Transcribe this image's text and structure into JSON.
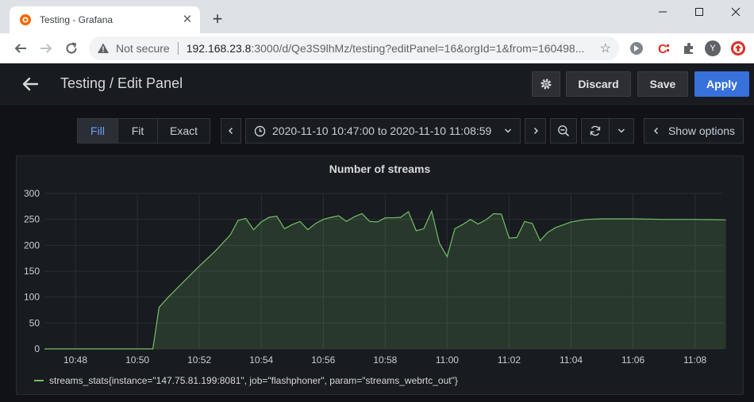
{
  "browser": {
    "tab_title": "Testing - Grafana",
    "security_label": "Not secure",
    "url_host": "192.168.23.8",
    "url_rest": ":3000/d/Qe3S9lhMz/testing?editPanel=16&orgId=1&from=160498...",
    "avatar_letter": "Y"
  },
  "header": {
    "title": "Testing / Edit Panel",
    "discard_label": "Discard",
    "save_label": "Save",
    "apply_label": "Apply"
  },
  "controls": {
    "fill_label": "Fill",
    "fit_label": "Fit",
    "exact_label": "Exact",
    "time_range": "2020-11-10 10:47:00 to 2020-11-10 11:08:59",
    "show_options_label": "Show options"
  },
  "colors": {
    "accent": "#3871dc",
    "series": "#73bf69",
    "background": "#111217",
    "panel": "#181b1f"
  },
  "chart_data": {
    "type": "area",
    "title": "Number of streams",
    "x_ticks": [
      "10:48",
      "10:50",
      "10:52",
      "10:54",
      "10:56",
      "10:58",
      "11:00",
      "11:02",
      "11:04",
      "11:06",
      "11:08"
    ],
    "x_range": [
      "10:47:00",
      "11:08:59"
    ],
    "ylim": [
      0,
      300
    ],
    "y_ticks": [
      0,
      50,
      100,
      150,
      200,
      250,
      300
    ],
    "grid": true,
    "legend": "bottom-left",
    "series": [
      {
        "name": "streams_stats{instance=\"147.75.81.199:8081\", job=\"flashphoner\", param=\"streams_webrtc_out\"}",
        "points": [
          [
            0,
            0
          ],
          [
            3,
            0
          ],
          [
            3.5,
            0
          ],
          [
            3.7,
            80
          ],
          [
            4,
            100
          ],
          [
            4.5,
            130
          ],
          [
            5,
            160
          ],
          [
            5.5,
            188
          ],
          [
            6,
            220
          ],
          [
            6.25,
            248
          ],
          [
            6.5,
            252
          ],
          [
            6.75,
            230
          ],
          [
            7,
            245
          ],
          [
            7.25,
            254
          ],
          [
            7.5,
            256
          ],
          [
            7.75,
            232
          ],
          [
            8,
            240
          ],
          [
            8.25,
            246
          ],
          [
            8.5,
            230
          ],
          [
            8.75,
            242
          ],
          [
            9,
            250
          ],
          [
            9.25,
            254
          ],
          [
            9.5,
            257
          ],
          [
            9.75,
            246
          ],
          [
            10,
            255
          ],
          [
            10.25,
            261
          ],
          [
            10.5,
            246
          ],
          [
            10.75,
            245
          ],
          [
            11,
            253
          ],
          [
            11.25,
            253
          ],
          [
            11.5,
            254
          ],
          [
            11.75,
            265
          ],
          [
            12,
            228
          ],
          [
            12.25,
            232
          ],
          [
            12.5,
            266
          ],
          [
            12.75,
            204
          ],
          [
            13,
            178
          ],
          [
            13.25,
            232
          ],
          [
            13.5,
            240
          ],
          [
            13.75,
            250
          ],
          [
            14,
            241
          ],
          [
            14.25,
            249
          ],
          [
            14.5,
            261
          ],
          [
            14.75,
            260
          ],
          [
            15,
            214
          ],
          [
            15.25,
            215
          ],
          [
            15.5,
            246
          ],
          [
            15.75,
            242
          ],
          [
            16,
            209
          ],
          [
            16.25,
            225
          ],
          [
            16.5,
            234
          ],
          [
            17,
            245
          ],
          [
            17.5,
            250
          ],
          [
            18,
            251
          ],
          [
            19,
            251
          ],
          [
            20,
            250
          ],
          [
            21,
            250
          ],
          [
            22,
            249
          ]
        ]
      }
    ]
  }
}
